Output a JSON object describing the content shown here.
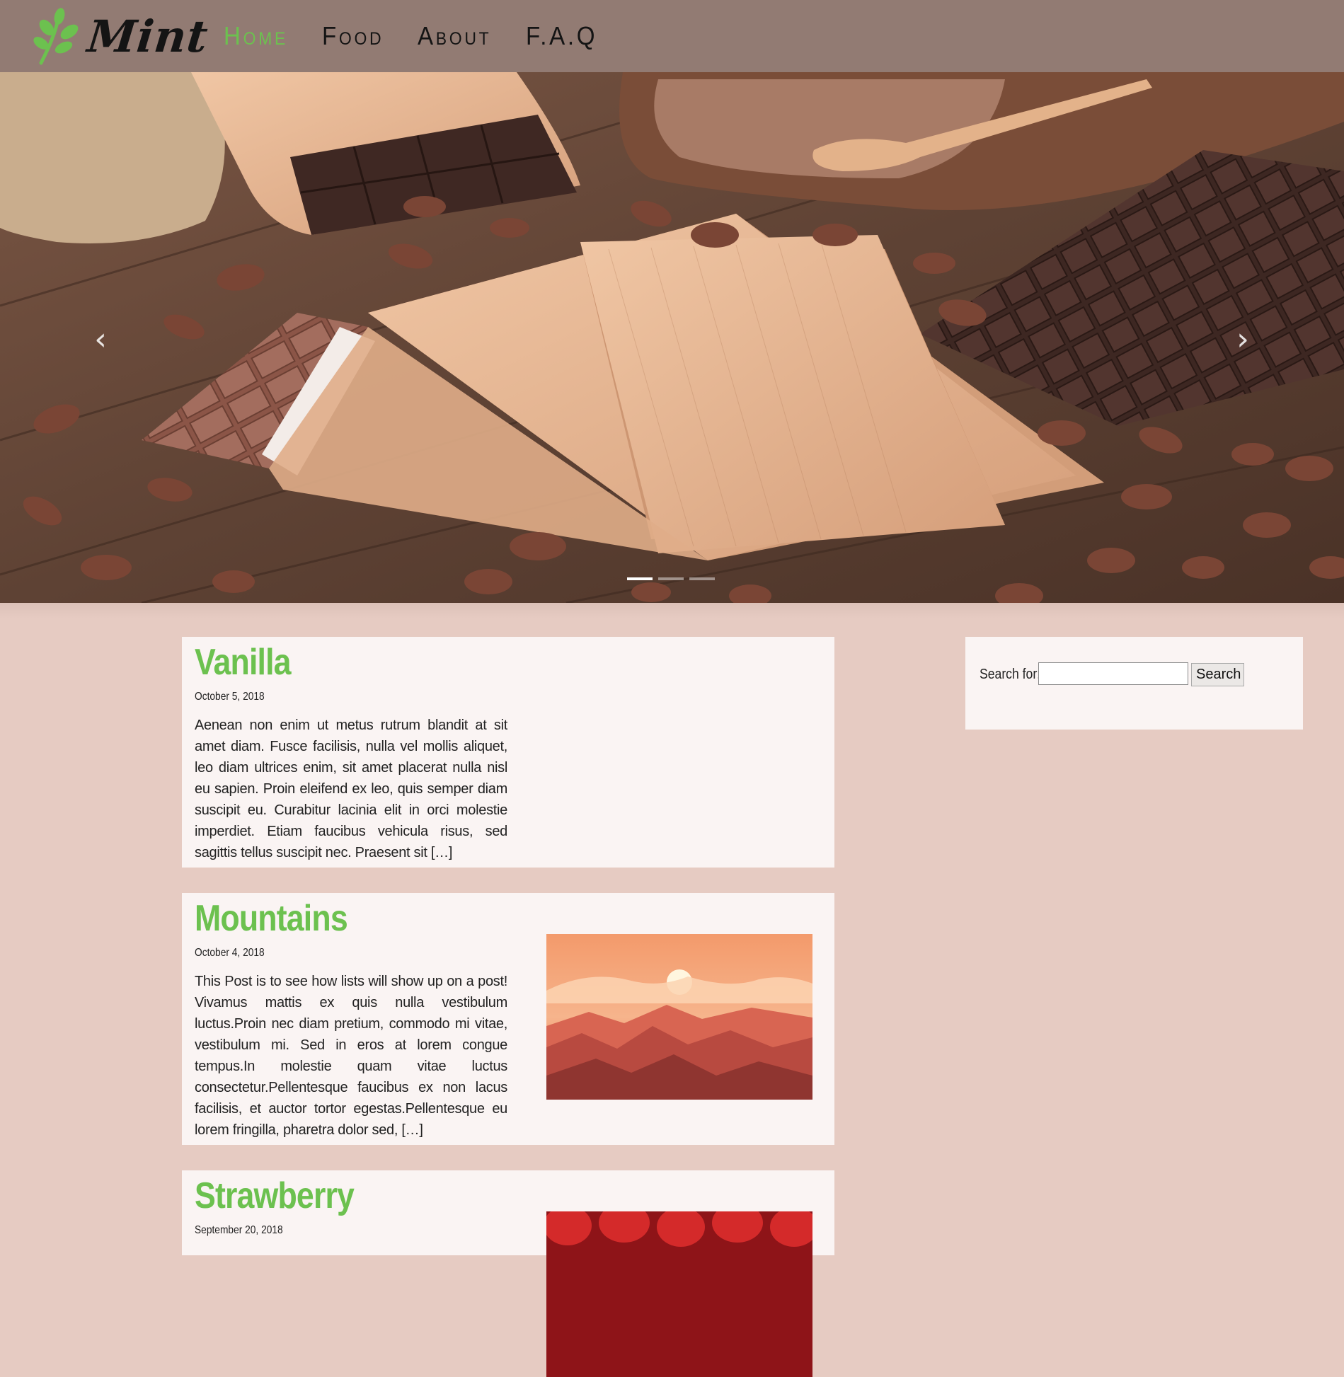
{
  "site": {
    "logo_text": "Mint"
  },
  "nav": {
    "items": [
      "Home",
      "Food",
      "About",
      "F.A.Q"
    ],
    "active_index": 0
  },
  "hero": {
    "prev_icon": "chevron-left-icon",
    "next_icon": "chevron-right-icon",
    "slide_count": 3,
    "active_slide": 0
  },
  "posts": [
    {
      "title": "Vanilla",
      "date": "October 5, 2018",
      "excerpt": "Aenean non enim ut metus rutrum blandit at sit amet diam. Fusce facilisis, nulla vel mollis aliquet, leo diam ultrices enim, sit amet placerat nulla nisl eu sapien. Proin eleifend ex leo, quis semper diam suscipit eu. Curabitur lacinia elit in orci molestie imperdiet. Etiam faucibus vehicula risus, sed sagittis tellus suscipit nec. Praesent sit […]"
    },
    {
      "title": "Mountains",
      "date": "October 4, 2018",
      "excerpt": "This Post is to see how lists will show up on a post! Vivamus mattis ex quis nulla vestibulum luctus.Proin nec diam pretium, commodo mi vitae, vestibulum mi. Sed in eros at lorem congue tempus.In molestie quam vitae luctus consectetur.Pellentesque faucibus ex non lacus facilisis, et auctor tortor egestas.Pellentesque eu lorem fringilla, pharetra dolor sed, […]"
    },
    {
      "title": "Strawberry",
      "date": "September 20, 2018"
    }
  ],
  "sidebar": {
    "search_label": "Search for:",
    "search_value": "",
    "search_button": "Search"
  },
  "colors": {
    "header_bg": "#927b73",
    "page_bg": "#e6cbc2",
    "card_bg": "#faf4f3",
    "accent_green": "#6cc14f"
  }
}
